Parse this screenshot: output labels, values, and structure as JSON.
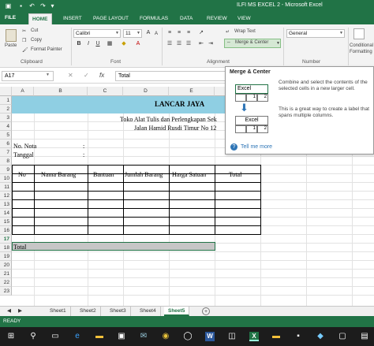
{
  "window": {
    "title": "ILFI MS EXCEL 2 -  Microsoft Excel"
  },
  "tabs": [
    {
      "label": "FILE"
    },
    {
      "label": "HOME"
    },
    {
      "label": "INSERT"
    },
    {
      "label": "PAGE LAYOUT"
    },
    {
      "label": "FORMULAS"
    },
    {
      "label": "DATA"
    },
    {
      "label": "REVIEW"
    },
    {
      "label": "VIEW"
    }
  ],
  "ribbon": {
    "clipboard": {
      "cut": "Cut",
      "copy": "Copy",
      "paste": "Paste",
      "format_painter": "Format Painter",
      "label": "Clipboard"
    },
    "font": {
      "name": "Calibri",
      "size": "11",
      "label": "Font"
    },
    "alignment": {
      "wrap_text": "Wrap Text",
      "merge_center": "Merge & Center",
      "label": "Alignment"
    },
    "number": {
      "format": "General",
      "label": "Number"
    },
    "styles": {
      "conditional_line1": "Conditional",
      "conditional_line2": "Formatting"
    }
  },
  "formula_bar": {
    "name_box": "A17",
    "fx": "fx",
    "value": "Total"
  },
  "columns": [
    "A",
    "B",
    "C",
    "D",
    "E"
  ],
  "rows": [
    "1",
    "2",
    "3",
    "4",
    "5",
    "6",
    "7",
    "8",
    "9",
    "10",
    "11",
    "12",
    "13",
    "14",
    "15",
    "16",
    "17",
    "18",
    "19",
    "20",
    "21",
    "22",
    "23"
  ],
  "cells": {
    "title": "LANCAR JAYA",
    "subtitle": "Toko Alat Tulis dan Perlengkapan Sek",
    "address": "Jalan Hamid Rusdi Timur No 12",
    "nota_label": "No. Nota",
    "tanggal_label": "Tanggal",
    "colon": ":",
    "headers": [
      "No",
      "Nama Barang",
      "Bantuan",
      "Jumlah Barang",
      "Harga Satuan",
      "Total"
    ],
    "total_label": "Total"
  },
  "tooltip": {
    "title": "Merge & Center",
    "description": "Combine and select the contents of the selected cells in a new larger cell.",
    "description2": "This is a great way to create a label that spans multiple columns.",
    "excel_label": "Excel",
    "num1": "1",
    "num2": "2",
    "tell_me_more": "Tell me more"
  },
  "sheets": [
    "Sheet1",
    "Sheet2",
    "Sheet3",
    "Sheet4",
    "Sheet5"
  ],
  "active_sheet": "Sheet5",
  "status": "READY",
  "colors": {
    "excel_green": "#217346",
    "title_fill": "#8fcfe3",
    "selection": "#c6c6c6"
  }
}
